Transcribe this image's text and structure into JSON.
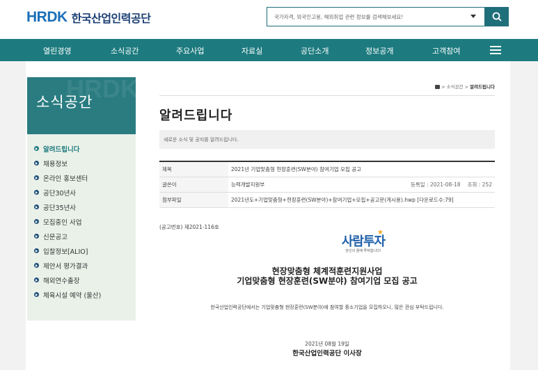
{
  "header": {
    "logo_mark_h": "HRD",
    "logo_mark_k": "K",
    "logo_name": "한국산업인력공단",
    "search_placeholder": "국가자격, 외국인고용, 해외취업 관련 정보를 검색해보세요!"
  },
  "nav": {
    "items": [
      "열린경영",
      "소식공간",
      "주요사업",
      "자료실",
      "공단소개",
      "정보공개",
      "고객참여"
    ]
  },
  "sidebar": {
    "title": "소식공간",
    "watermark": "HRDK",
    "items": [
      {
        "label": "알려드립니다",
        "active": true
      },
      {
        "label": "채용정보"
      },
      {
        "label": "온라인 홍보센터"
      },
      {
        "label": "공단30년사"
      },
      {
        "label": "공단35년사"
      },
      {
        "label": "모집중인 사업"
      },
      {
        "label": "신문공고"
      },
      {
        "label": "입찰정보[ALIO]"
      },
      {
        "label": "제안서 평가결과"
      },
      {
        "label": "해외연수출장"
      },
      {
        "label": "체육시설 예약 (울산)"
      }
    ]
  },
  "breadcrumb": {
    "path": "> 소식공간 > ",
    "current": "알려드립니다"
  },
  "main": {
    "title": "알려드립니다",
    "description": "새로운 소식 및 공지를 알려드립니다.",
    "table": {
      "subject_label": "제목",
      "subject_value": "2021년 기업맞춤형 현장훈련(SW분야) 참여기업 모집 공고",
      "author_label": "글쓴이",
      "author_value": "능력개발지원부",
      "date_text": "등록일 : 2021-08-18",
      "views_text": "조회 : 252",
      "attach_label": "첨부파일",
      "attach_value": "2021년도+기업맞춤형+현장훈련(SW분야)+참여기업+모집+공고문(게시용).hwp [다운로드수:79]"
    },
    "notice_number": "(공고번호) 제2021-116호",
    "brand_text": "사람투자",
    "brand_sub": "당신의 꿈에 투자합니다!",
    "headline_1": "현장맞춤형 체계적훈련지원사업",
    "headline_2": "기업맞춤형 현장훈련(SW분야) 참여기업 모집 공고",
    "body": "한국산업인력공단에서는 기업맞춤형 현장훈련(SW분야)에 참여할 중소기업을 모집하오니, 많은 관심 부탁드립니다.",
    "date": "2021년 08월 19일",
    "signer": "한국산업인력공단 이사장"
  },
  "colors": {
    "nav": "#1d7b7f",
    "sidebar_head": "#2a7c81",
    "sidebar_list": "#eaf1e9",
    "logo_blue": "#1b6fb8"
  }
}
